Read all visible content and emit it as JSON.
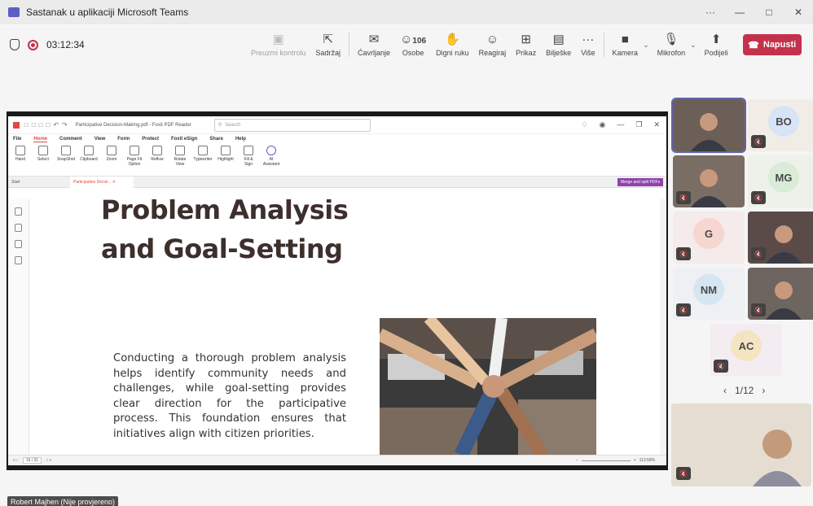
{
  "window": {
    "title": "Sastanak u aplikaciji Microsoft Teams",
    "more": "···",
    "minimize": "—",
    "maximize": "□",
    "close": "✕"
  },
  "meeting": {
    "timer": "03:12:34",
    "recording": true
  },
  "toolbar": {
    "take_control": "Preuzmi kontrolu",
    "content": "Sadržaj",
    "chat": "Ćavrljanje",
    "people": "Osobe",
    "people_count": "106",
    "raise_hand": "Digni ruku",
    "react": "Reagiraj",
    "view": "Prikaz",
    "notes": "Bilješke",
    "more": "Više",
    "camera": "Kamera",
    "mic": "Mikrofon",
    "share": "Podijeli",
    "leave": "Napusti"
  },
  "foxit": {
    "doc_title": "Participative Decision-Making.pdf - Foxit PDF Reader",
    "search_placeholder": "Search",
    "menu": [
      "File",
      "Home",
      "Comment",
      "View",
      "Form",
      "Protect",
      "Foxit eSign",
      "Share",
      "Help"
    ],
    "ribbon": [
      "Hand",
      "Select",
      "SnapShot",
      "Clipboard",
      "Zoom",
      "Page Fit Option",
      "Reflow",
      "Rotate View",
      "Typewriter",
      "Highlight",
      "Fill & Sign",
      "AI Assistant"
    ],
    "tabs": [
      "Start",
      "Participative Decisi..."
    ],
    "merge_label": "Merge and split PDFs",
    "page_indicator": "16 / 31",
    "zoom": "113.50%"
  },
  "slide": {
    "heading_line1": "Problem Analysis",
    "heading_line2": "and Goal-Setting",
    "body": "Conducting a thorough problem analysis helps identify community needs and challenges, while goal-setting provides clear direction for the participative process. This foundation ensures that initiatives align with citizen priorities."
  },
  "participants": [
    {
      "initials": "",
      "video": true,
      "muted": false,
      "active": true
    },
    {
      "initials": "BO",
      "video": false,
      "muted": true
    },
    {
      "initials": "",
      "video": true,
      "muted": true
    },
    {
      "initials": "MG",
      "video": false,
      "muted": true
    },
    {
      "initials": "G",
      "video": false,
      "muted": true
    },
    {
      "initials": "",
      "video": true,
      "muted": true
    },
    {
      "initials": "NM",
      "video": false,
      "muted": true
    },
    {
      "initials": "",
      "video": true,
      "muted": true
    },
    {
      "initials": "AC",
      "video": false,
      "muted": true
    },
    {
      "initials": "",
      "video": true,
      "muted": true
    }
  ],
  "pager": {
    "label": "1/12"
  },
  "presenter_tag": "Robert Majhen (Nije provjereno)",
  "colors": {
    "leave": "#c4314b",
    "teams_accent": "#6264a7",
    "foxit_accent": "#e2483d",
    "heading": "#3d2f2c"
  }
}
